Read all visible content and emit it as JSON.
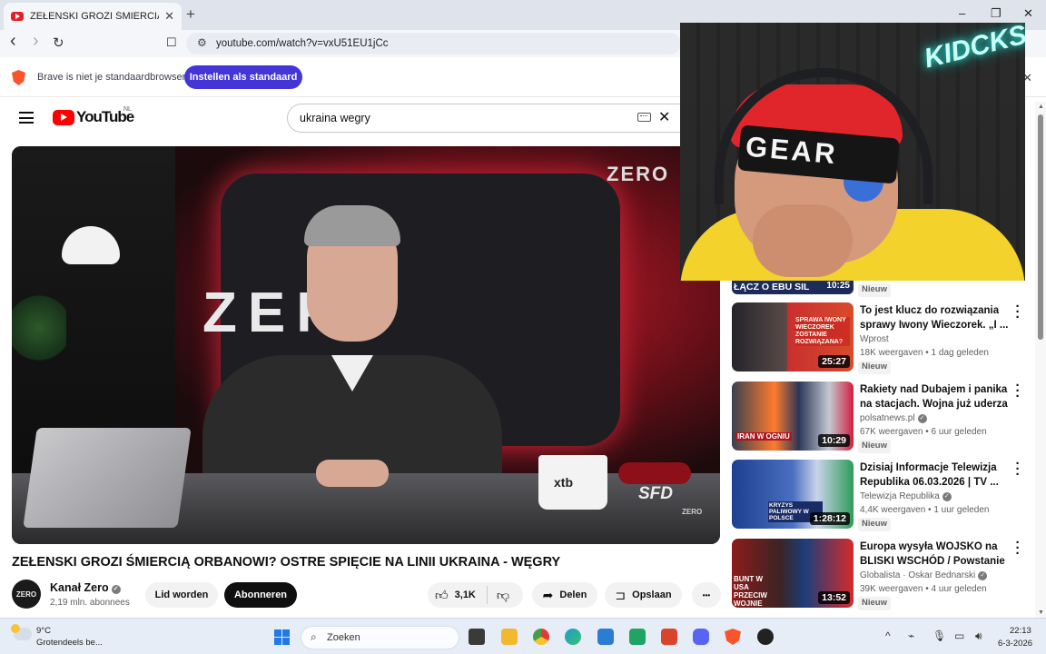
{
  "browser": {
    "tab_title": "ZEŁENSKI GROZI ŚMIERCIĄ ORB",
    "tab_close": "✕",
    "new_tab": "+",
    "url": "youtube.com/watch?v=vxU51EU1jCc",
    "window_controls": {
      "minimize": "–",
      "maximize": "❐",
      "close": "✕"
    },
    "nav": {
      "back": "‹",
      "forward": "›",
      "reload": "↻",
      "bookmark": "☐"
    }
  },
  "infobar": {
    "message": "Brave is niet je standaardbrowser",
    "button": "Instellen als standaard",
    "close": "✕"
  },
  "youtube": {
    "logo_text": "YouTube",
    "country": "NL",
    "search_value": "ukraina wegry",
    "clear": "✕"
  },
  "video": {
    "title": "ZEŁENSKI GROZI ŚMIERCIĄ ORBANOWI? OSTRE SPIĘCIE NA LINII UKRAINA - WĘGRY",
    "channel": "Kanał Zero",
    "avatar_text": "ZERO",
    "subscribers": "2,19 mln. abonnees",
    "join": "Lid worden",
    "subscribe": "Abonneren",
    "likes": "3,1K",
    "share": "Delen",
    "save": "Opslaan",
    "more": "•••",
    "overlay": {
      "studio_logo": "ZER",
      "corner_logo": "ZERO",
      "mug": "xtb",
      "brand": "SFD",
      "watermark": "ZERO"
    }
  },
  "sidebar": {
    "prev": {
      "title": "ŁĄCZ O EBU SIL",
      "duration": "10:25",
      "badge": "Nieuw"
    },
    "items": [
      {
        "title": "To jest klucz do rozwiązania sprawy Iwony Wieczorek. „I ...",
        "channel": "Wprost",
        "meta": "18K weergaven • 1 dag geleden",
        "badge": "Nieuw",
        "duration": "25:27",
        "thumb_caption": "SPRAWA IWONY WIECZOREK ZOSTANIE ROZWIĄZANA?"
      },
      {
        "title": "Rakiety nad Dubajem i panika na stacjach. Wojna już uderza ...",
        "channel": "polsatnews.pl",
        "meta": "67K weergaven • 6 uur geleden",
        "badge": "Nieuw",
        "duration": "10:29",
        "thumb_caption": "IRAN W OGNIU"
      },
      {
        "title": "Dzisiaj Informacje Telewizja Republika 06.03.2026 | TV ...",
        "channel": "Telewizja Republika",
        "meta": "4,4K weergaven • 1 uur geleden",
        "badge": "Nieuw",
        "duration": "1:28:12",
        "thumb_caption": "KRYZYS PALIWOWY W POLSCE"
      },
      {
        "title": "Europa wysyła WOJSKO na BLISKI WSCHÓD / Powstanie ...",
        "channel": "Globalista · Oskar Bednarski",
        "meta": "39K weergaven • 4 uur geleden",
        "badge": "Nieuw",
        "duration": "13:52",
        "thumb_caption": "BUNT W USA PRZECIW WOJNIE"
      }
    ]
  },
  "webcam": {
    "neon_sign": "KIDCKS",
    "beanie_text": "GEAR"
  },
  "taskbar": {
    "temperature": "9°C",
    "weather": "Grotendeels be...",
    "search_placeholder": "Zoeken",
    "time": "22:13",
    "date": "6-3-2026"
  }
}
